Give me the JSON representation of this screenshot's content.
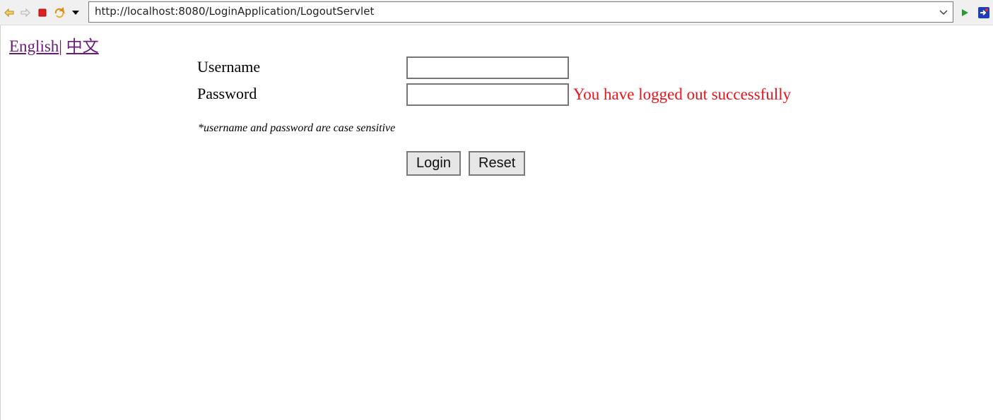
{
  "browser": {
    "url": "http://localhost:8080/LoginApplication/LogoutServlet",
    "icons": {
      "back": "back-arrow-icon",
      "forward": "forward-arrow-icon",
      "stop": "stop-icon",
      "refresh": "refresh-icon",
      "menu": "dropdown-triangle-icon",
      "go": "go-play-icon",
      "extension": "extension-icon"
    },
    "colors": {
      "stop": "#e02020",
      "refresh": "#e8a020",
      "go": "#2e9a2e",
      "extension": "#1d3fb8"
    }
  },
  "page": {
    "languages": {
      "english": "English",
      "separator": "|",
      "chinese": "中文"
    },
    "form": {
      "username_label": "Username",
      "password_label": "Password",
      "username_value": "",
      "password_value": "",
      "status_message": "You have logged out successfully",
      "case_note": "*username and password are case sensitive",
      "login_label": "Login",
      "reset_label": "Reset"
    },
    "colors": {
      "link": "#6a1a7a",
      "status_message": "#e8141c"
    }
  }
}
